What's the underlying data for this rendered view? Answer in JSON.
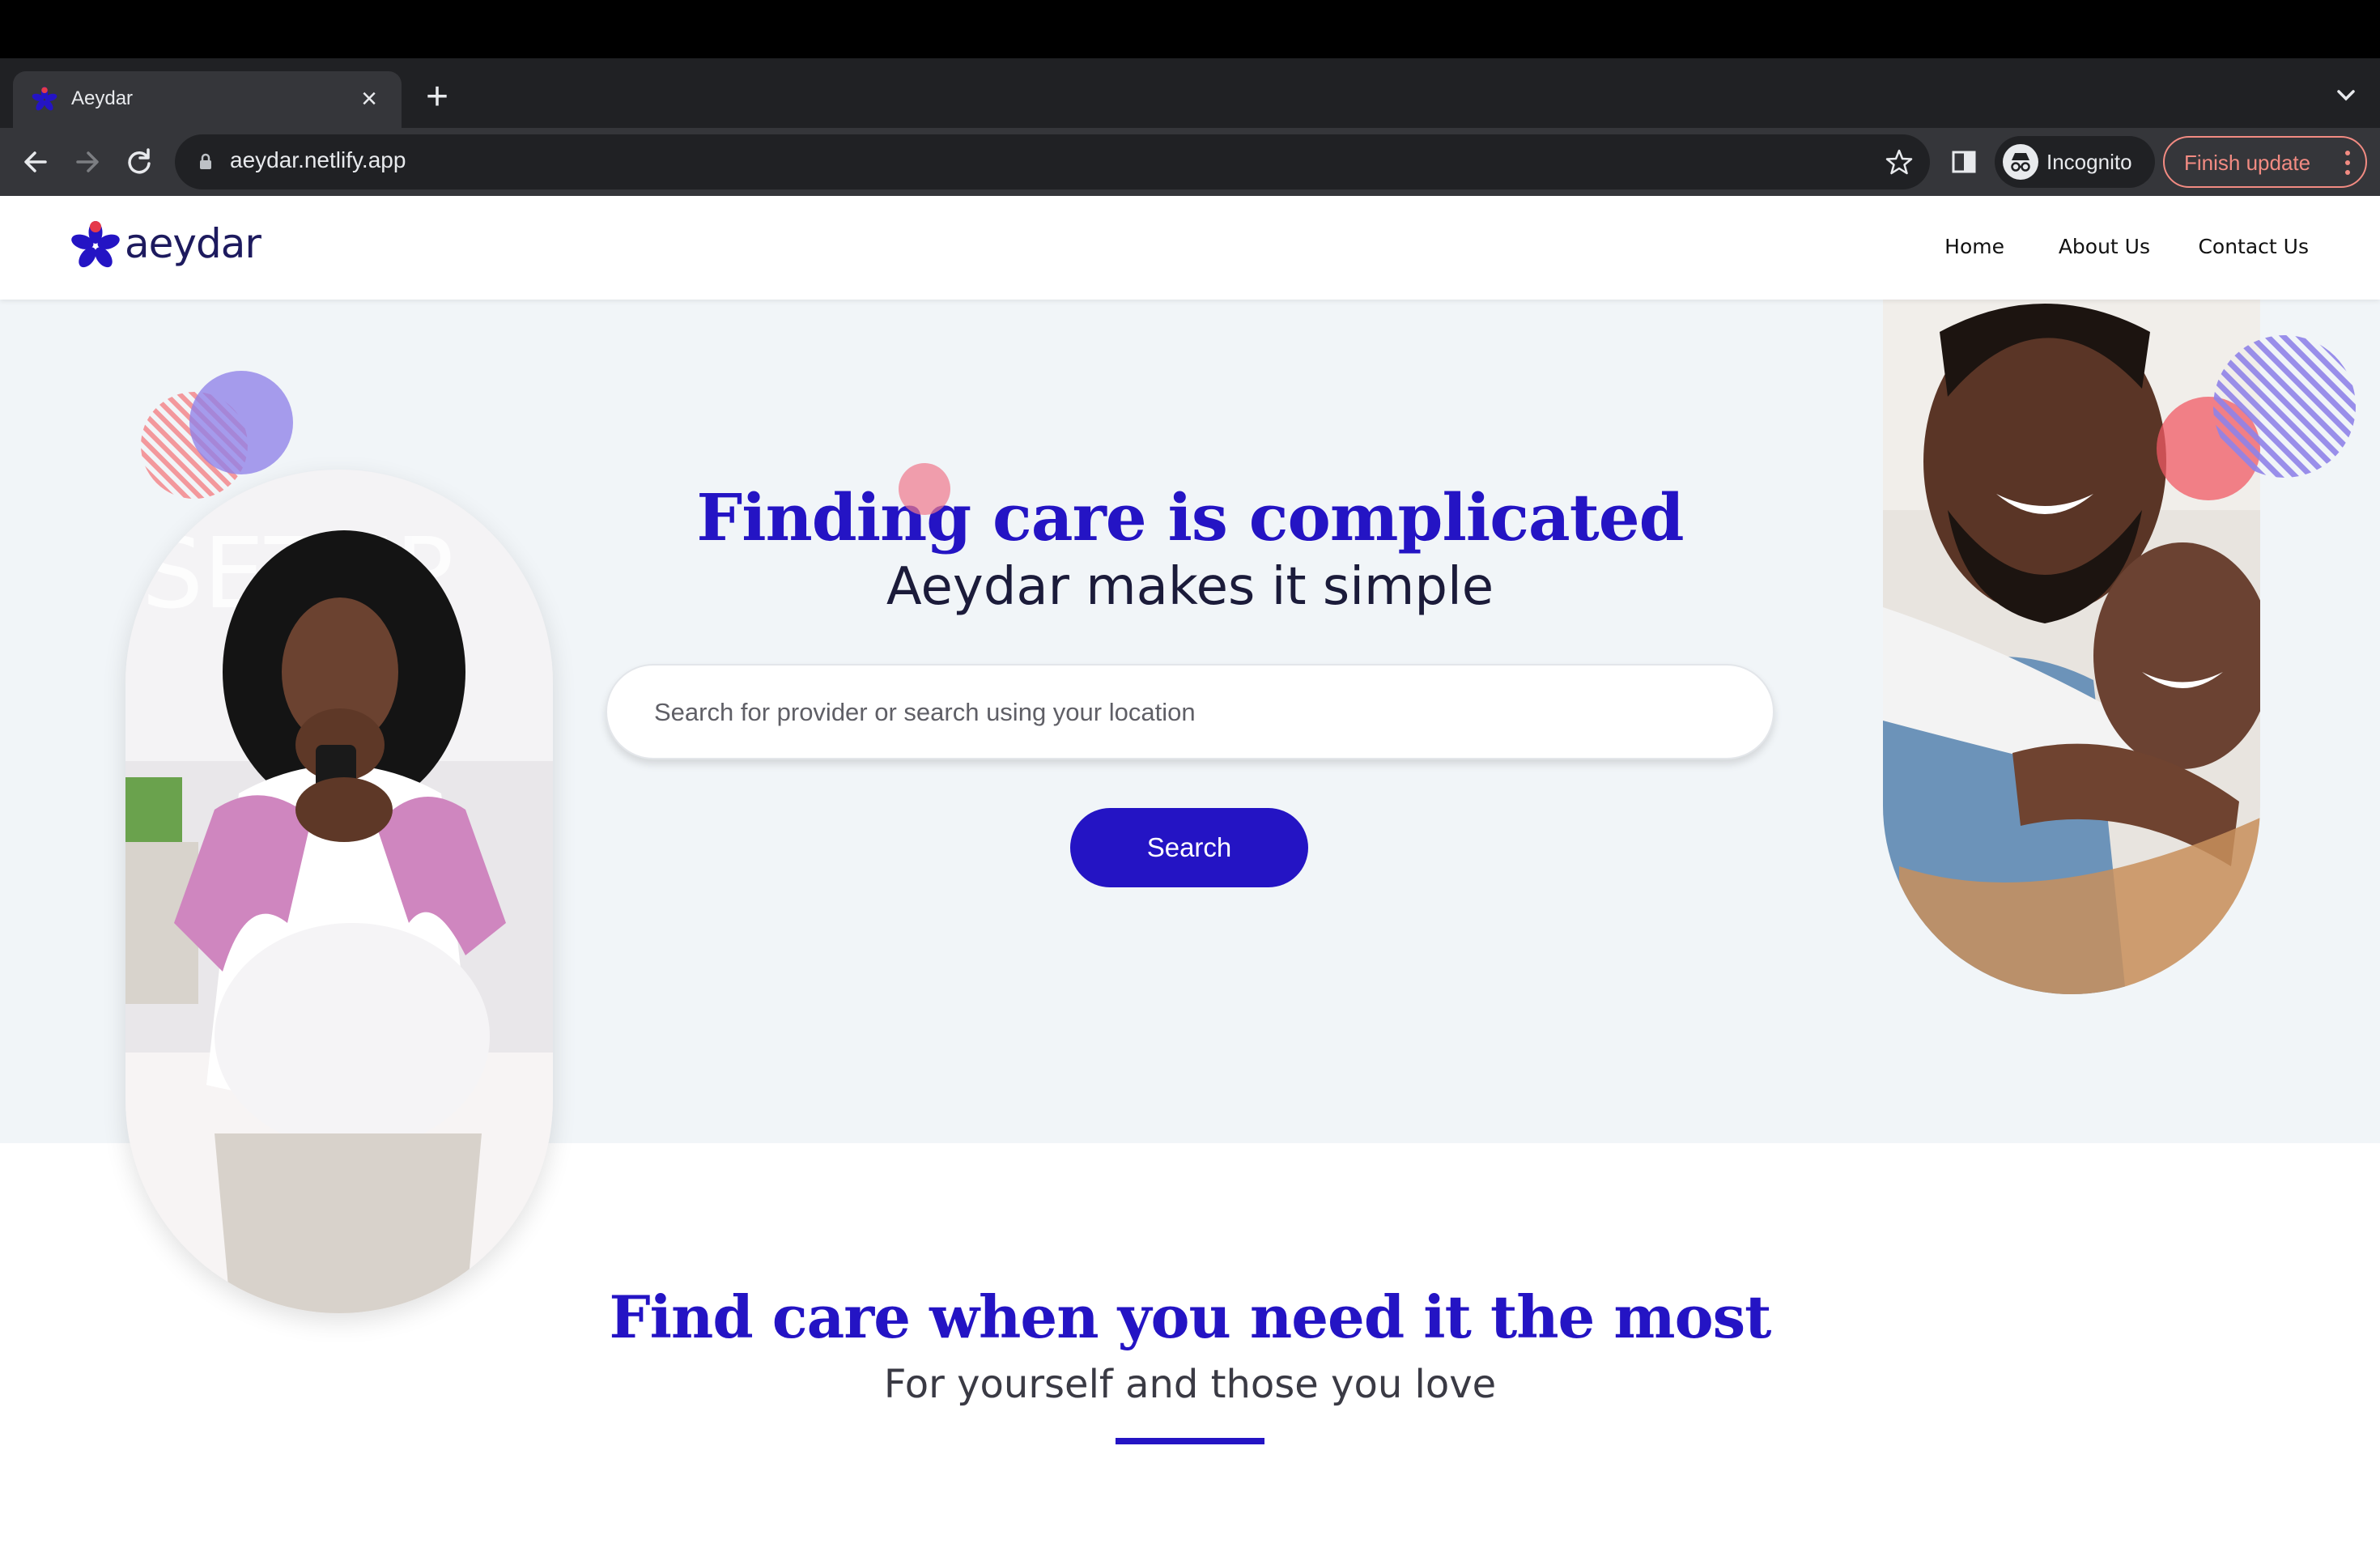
{
  "browser": {
    "tab_title": "Aeydar",
    "url": "aeydar.netlify.app",
    "incognito_label": "Incognito",
    "finish_update_label": "Finish update",
    "tab_close_glyph": "×",
    "new_tab_glyph": "+"
  },
  "site": {
    "logo_text": "aeydar",
    "nav": [
      "Home",
      "About Us",
      "Contact Us"
    ]
  },
  "hero": {
    "headline": "Finding care is complicated",
    "subline": "Aeydar makes it simple",
    "search_placeholder": "Search for provider or search using your location",
    "search_button": "Search"
  },
  "section2": {
    "title": "Find care when you need it the most",
    "subtitle": "For yourself and those you love"
  },
  "colors": {
    "brand": "#2414c4",
    "hero_bg": "#f1f5f8",
    "accent_pink": "#f08f96",
    "accent_purple": "#8f82e8"
  }
}
